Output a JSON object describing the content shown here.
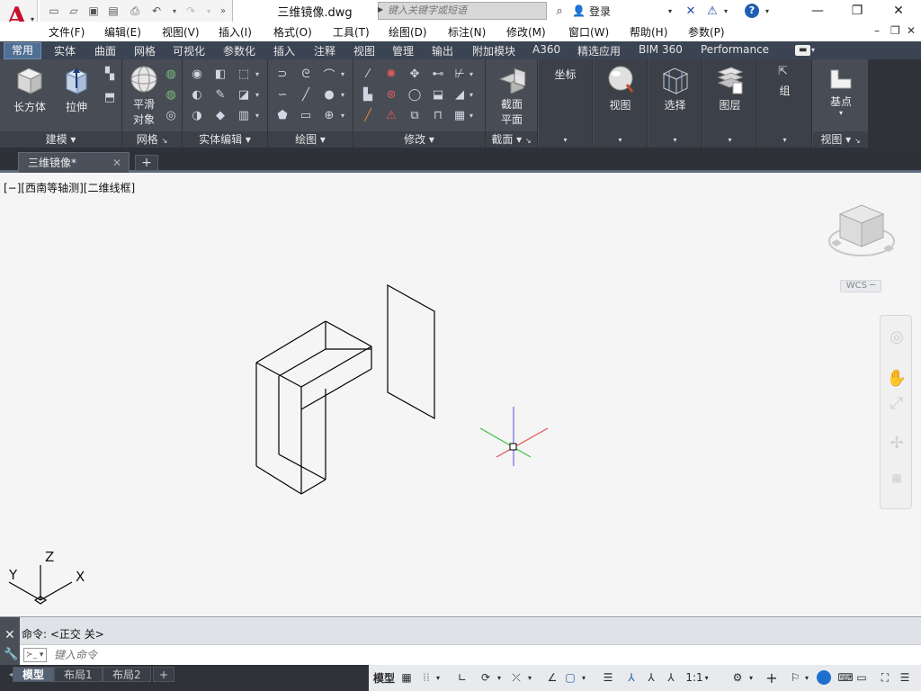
{
  "titlebar": {
    "doc_title": "三维镜像.dwg",
    "search_placeholder": "键入关键字或短语",
    "login_label": "登录",
    "help_label": "?"
  },
  "menu": {
    "items": [
      "文件(F)",
      "编辑(E)",
      "视图(V)",
      "插入(I)",
      "格式(O)",
      "工具(T)",
      "绘图(D)",
      "标注(N)",
      "修改(M)",
      "窗口(W)",
      "帮助(H)",
      "参数(P)"
    ]
  },
  "ribbon_tabs": [
    "常用",
    "实体",
    "曲面",
    "网格",
    "可视化",
    "参数化",
    "插入",
    "注释",
    "视图",
    "管理",
    "输出",
    "附加模块",
    "A360",
    "精选应用",
    "BIM 360",
    "Performance"
  ],
  "ribbon": {
    "modeling": {
      "title": "建模",
      "box": "长方体",
      "extrude": "拉伸"
    },
    "mesh": {
      "title": "网格",
      "smooth": "平滑\n对象",
      "smooth_l1": "平滑",
      "smooth_l2": "对象"
    },
    "solid_edit": {
      "title": "实体编辑"
    },
    "draw": {
      "title": "绘图"
    },
    "modify": {
      "title": "修改"
    },
    "section": {
      "title": "截面",
      "plane_l1": "截面",
      "plane_l2": "平面"
    },
    "coords": {
      "label": "坐标"
    },
    "view_btn": {
      "label": "视图"
    },
    "select_btn": {
      "label": "选择"
    },
    "layers_btn": {
      "label": "图层"
    },
    "group_btn": {
      "label": "组"
    },
    "basepoint": {
      "label": "基点"
    },
    "view_panel": {
      "title": "视图"
    }
  },
  "doc_tab": {
    "label": "三维镜像*"
  },
  "canvas": {
    "view_label": "[−][西南等轴测][二维线框]",
    "wcs_label": "WCS",
    "ucs_x": "X",
    "ucs_y": "Y",
    "ucs_z": "Z"
  },
  "command": {
    "history": "命令:  <正交 关>",
    "placeholder": "键入命令"
  },
  "layout_tabs": [
    "模型",
    "布局1",
    "布局2"
  ],
  "status": {
    "model_label": "模型",
    "scale_label": "1:1"
  },
  "colors": {
    "accent": "#4f6f94",
    "ribbon_bg": "#474c55",
    "canvas_bg": "#f5f5f5",
    "app_red": "#c8102e"
  }
}
